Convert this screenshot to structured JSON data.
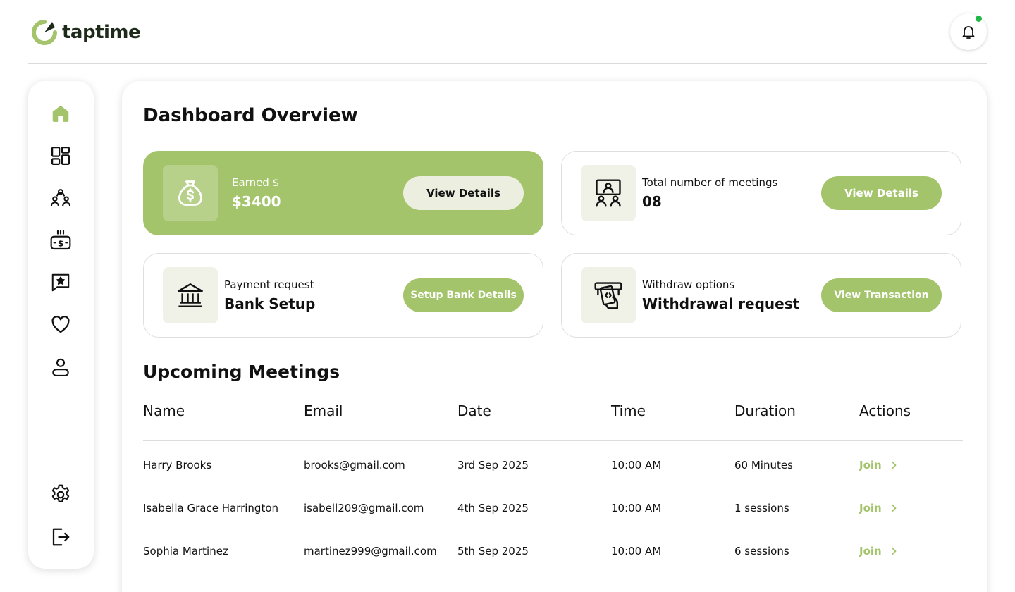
{
  "app": {
    "logo_text": "taptime"
  },
  "colors": {
    "accent": "#a3c46b",
    "notification_dot": "#1fb845"
  },
  "header": {
    "notification_icon": "bell-icon"
  },
  "sidebar": {
    "items": [
      {
        "icon": "home-icon",
        "active": true
      },
      {
        "icon": "dashboard-grid-icon"
      },
      {
        "icon": "users-group-icon"
      },
      {
        "icon": "dollar-wallet-icon"
      },
      {
        "icon": "star-message-icon"
      },
      {
        "icon": "heart-icon"
      },
      {
        "icon": "user-profile-icon"
      },
      {
        "icon": "settings-gear-icon"
      },
      {
        "icon": "logout-icon"
      }
    ]
  },
  "dashboard": {
    "title": "Dashboard Overview",
    "cards": [
      {
        "icon": "money-bag-icon",
        "label": "Earned $",
        "value": "$3400",
        "button": "View Details"
      },
      {
        "icon": "meeting-icon",
        "label": "Total number of meetings",
        "value": "08",
        "button": "View Details"
      },
      {
        "icon": "bank-icon",
        "label": "Payment request",
        "value": "Bank Setup",
        "button": "Setup Bank Details"
      },
      {
        "icon": "withdraw-icon",
        "label": "Withdraw options",
        "value": "Withdrawal request",
        "button": "View Transaction"
      }
    ]
  },
  "meetings": {
    "title": "Upcoming Meetings",
    "columns": [
      "Name",
      "Email",
      "Date",
      "Time",
      "Duration",
      "Actions"
    ],
    "rows": [
      {
        "name": "Harry Brooks",
        "email": "brooks@gmail.com",
        "date": "3rd Sep 2025",
        "time": "10:00 AM",
        "duration": "60 Minutes",
        "action": "Join"
      },
      {
        "name": "Isabella Grace Harrington",
        "email": "isabell209@gmail.com",
        "date": "4th Sep 2025",
        "time": "10:00 AM",
        "duration": "1 sessions",
        "action": "Join"
      },
      {
        "name": "Sophia Martinez",
        "email": "martinez999@gmail.com",
        "date": "5th Sep 2025",
        "time": "10:00 AM",
        "duration": "6 sessions",
        "action": "Join"
      }
    ]
  }
}
